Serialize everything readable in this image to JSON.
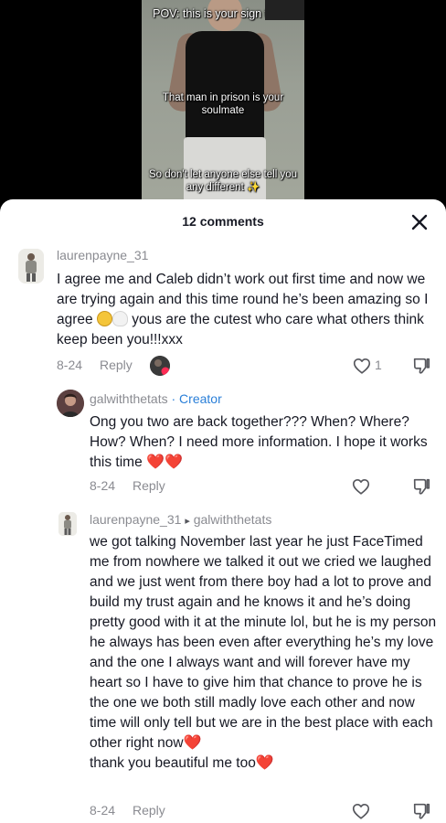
{
  "video": {
    "overlay_line1": "POV: this is your sign that...",
    "overlay_line2": "That man in prison is your soulmate",
    "overlay_line3": "So don't let anyone else tell you any different ✨"
  },
  "sheet": {
    "title": "12 comments",
    "close_icon": "close-icon"
  },
  "comments": [
    {
      "username": "laurenpayne_31",
      "text_part1": "I agree me and Caleb didn’t work out first time and now we are trying again and this time round he’s been amazing so I agree",
      "text_part2": " yous are the cutest who care what others think keep been you!!!xxx",
      "date": "8-24",
      "reply_label": "Reply",
      "like_count": "1"
    },
    {
      "username": "galwiththetats",
      "creator_label": "· Creator",
      "text": "Ong you two are back together??? When? Where? How? When? I need more information. I hope it works this time",
      "hearts": "❤️❤️",
      "date": "8-24",
      "reply_label": "Reply"
    },
    {
      "username": "laurenpayne_31",
      "reply_arrow": "▸",
      "reply_to": "galwiththetats",
      "text": "we got talking November last year he just FaceTimed me from nowhere we talked it out we cried we laughed and we just went from there boy had a lot to prove and build my trust again and he knows it and he’s doing pretty good with it at the minute lol, but he is my person he always has been even after everything he’s my love and the one I always want and will forever have my heart so I have to give him that chance to prove he is the one we both still madly love each other and now time will only tell but we are in the best place with each other right now",
      "heart1": "❤️",
      "text_end": "thank you beautiful me too",
      "heart2": "❤️",
      "date": "8-24",
      "reply_label": "Reply"
    }
  ]
}
